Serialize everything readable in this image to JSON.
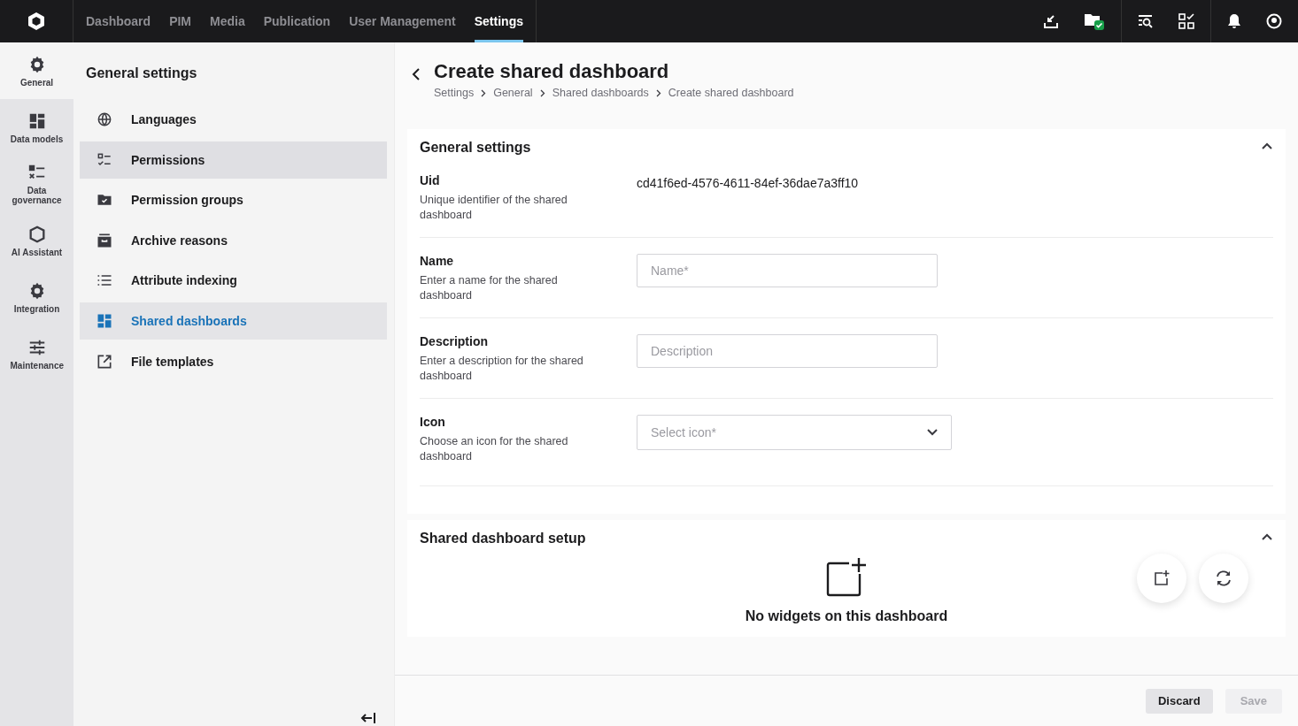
{
  "top_nav": {
    "tabs": [
      {
        "label": "Dashboard",
        "selected": false
      },
      {
        "label": "PIM",
        "selected": false
      },
      {
        "label": "Media",
        "selected": false
      },
      {
        "label": "Publication",
        "selected": false
      },
      {
        "label": "User Management",
        "selected": false
      },
      {
        "label": "Settings",
        "selected": true
      }
    ]
  },
  "rail": {
    "items": [
      {
        "label": "General",
        "selected": true
      },
      {
        "label": "Data models",
        "selected": false
      },
      {
        "label": "Data governance",
        "selected": false
      },
      {
        "label": "AI Assistant",
        "selected": false
      },
      {
        "label": "Integration",
        "selected": false
      },
      {
        "label": "Maintenance",
        "selected": false
      }
    ]
  },
  "sidebar": {
    "title": "General settings",
    "items": [
      {
        "label": "Languages",
        "selected": false,
        "hovered": false
      },
      {
        "label": "Permissions",
        "selected": false,
        "hovered": true
      },
      {
        "label": "Permission groups",
        "selected": false,
        "hovered": false
      },
      {
        "label": "Archive reasons",
        "selected": false,
        "hovered": false
      },
      {
        "label": "Attribute indexing",
        "selected": false,
        "hovered": false
      },
      {
        "label": "Shared dashboards",
        "selected": true,
        "hovered": false
      },
      {
        "label": "File templates",
        "selected": false,
        "hovered": false
      }
    ]
  },
  "page": {
    "title": "Create shared dashboard",
    "breadcrumb": [
      "Settings",
      "General",
      "Shared dashboards",
      "Create shared dashboard"
    ]
  },
  "general_section": {
    "title": "General settings",
    "expanded": true,
    "fields": [
      {
        "kind": "text",
        "label": "Uid",
        "hint": "Unique identifier of the shared dashboard",
        "value": "cd41f6ed-4576-4611-84ef-36dae7a3ff10"
      },
      {
        "kind": "input",
        "label": "Name",
        "hint": "Enter a name for the shared dashboard",
        "placeholder": "Name*"
      },
      {
        "kind": "input",
        "label": "Description",
        "hint": "Enter a description for the shared dashboard",
        "placeholder": "Description"
      },
      {
        "kind": "select",
        "label": "Icon",
        "hint": "Choose an icon for the shared dashboard",
        "placeholder": "Select icon*"
      }
    ]
  },
  "setup_section": {
    "title": "Shared dashboard setup",
    "expanded": true,
    "empty_message": "No widgets on this dashboard"
  },
  "footer": {
    "buttons": [
      {
        "label": "Discard",
        "disabled": false
      },
      {
        "label": "Save",
        "disabled": true
      }
    ]
  }
}
